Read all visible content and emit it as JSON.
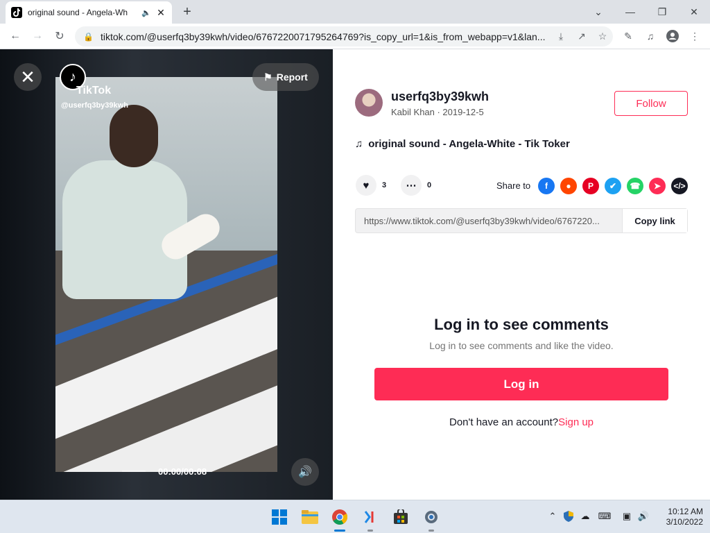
{
  "browser": {
    "tab_title": "original sound - Angela-Wh",
    "url": "tiktok.com/@userfq3by39kwh/video/6767220071795264769?is_copy_url=1&is_from_webapp=v1&lan..."
  },
  "video": {
    "watermark_brand": "TikTok",
    "watermark_user": "@userfq3by39kwh",
    "report_label": "Report",
    "time": "00:00/00:08",
    "progress": 0.0
  },
  "author": {
    "username": "userfq3by39kwh",
    "subline": "Kabil Khan · 2019-12-5",
    "follow_label": "Follow"
  },
  "music": "original sound - Angela-White - Tik Toker",
  "stats": {
    "likes": "3",
    "comments": "0",
    "share_label": "Share to"
  },
  "share_targets": [
    "facebook",
    "reddit",
    "pinterest",
    "twitter",
    "whatsapp",
    "telegram",
    "embed"
  ],
  "link": {
    "url": "https://www.tiktok.com/@userfq3by39kwh/video/6767220...",
    "copy_label": "Copy link"
  },
  "login": {
    "title": "Log in to see comments",
    "subtitle": "Log in to see comments and like the video.",
    "button": "Log in",
    "no_account": "Don't have an account?",
    "signup": "Sign up"
  },
  "taskbar": {
    "time": "10:12 AM",
    "date": "3/10/2022"
  },
  "colors": {
    "accent": "#fe2c55",
    "facebook": "#1877f2",
    "reddit": "#ff4500",
    "pinterest": "#e60023",
    "twitter": "#1da1f2",
    "whatsapp": "#25d366",
    "telegram": "#fe2c55",
    "embed": "#161823"
  }
}
